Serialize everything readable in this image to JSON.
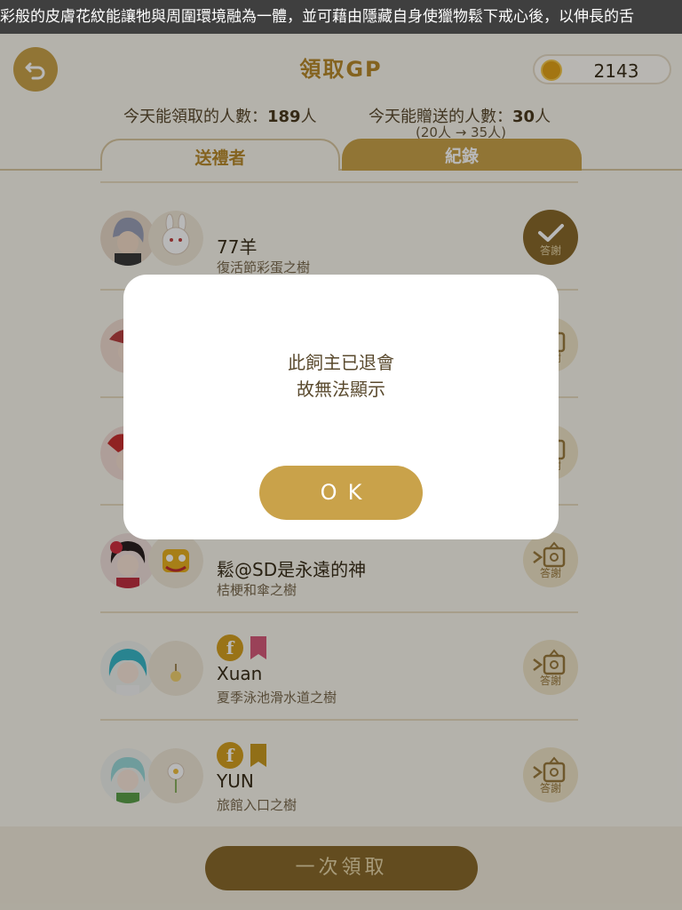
{
  "ticker": {
    "text": "彩般的皮膚花紋能讓牠與周圍環境融為一體，並可藉由隱藏自身使獵物鬆下戒心後，以伸長的舌"
  },
  "header": {
    "title": "領取GP",
    "gp_amount": "2143"
  },
  "counts": {
    "receive_label": "今天能領取的人數：",
    "receive_value": "189",
    "receive_unit": "人",
    "gift_label": "今天能贈送的人數：",
    "gift_value": "30",
    "gift_unit": "人",
    "gift_note": "(20人 → 35人)"
  },
  "tabs": [
    {
      "label": "送禮者"
    },
    {
      "label": "紀錄"
    }
  ],
  "rows": [
    {
      "name": "77羊",
      "tree": "復活節彩蛋之樹",
      "thank_label": "答謝",
      "thanked": true
    },
    {
      "name": "",
      "tree": "",
      "thank_label": "答謝",
      "thanked": false
    },
    {
      "name": "",
      "tree": "",
      "thank_label": "答謝",
      "thanked": false
    },
    {
      "name": "鬆@SD是永遠的神",
      "tree": "桔梗和傘之樹",
      "thank_label": "答謝",
      "thanked": false
    },
    {
      "name": "Xuan",
      "tree": "夏季泳池滑水道之樹",
      "thank_label": "答謝",
      "thanked": false
    },
    {
      "name": "YUN",
      "tree": "旅館入口之樹",
      "thank_label": "答謝",
      "thanked": false
    }
  ],
  "footer": {
    "claim_all_label": "一次領取"
  },
  "modal": {
    "line1": "此飼主已退會",
    "line2": "故無法顯示",
    "ok_label": "OK"
  },
  "colors": {
    "accent": "#c9a24a",
    "accent_dark": "#8a6a2c",
    "facebook": "#d4a020",
    "flag_pink": "#d65a7a",
    "flag_green": "#4a8a2a",
    "flag_gold": "#c99a20"
  }
}
